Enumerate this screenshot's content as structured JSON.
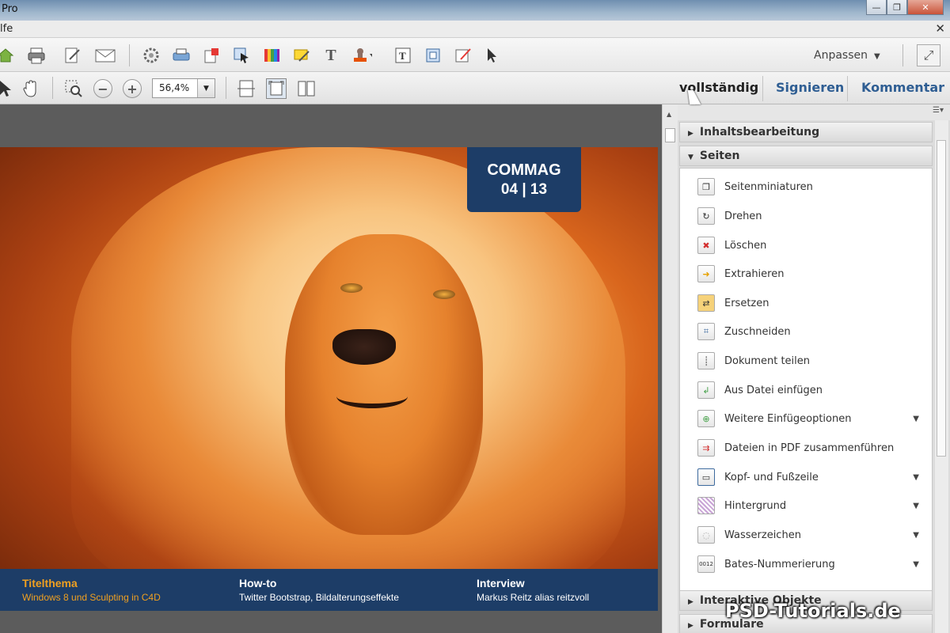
{
  "window": {
    "title": "Pro",
    "minimize": "—",
    "maximize": "❐",
    "close": "✕"
  },
  "menubar": {
    "menu_label": "lfe",
    "close": "✕"
  },
  "toolbar": {
    "icons": [
      "home-icon",
      "print-icon",
      "edit-icon",
      "mail-icon",
      "gear-icon",
      "printer2-icon",
      "export-icon",
      "select-icon",
      "color-icon",
      "comment-icon",
      "text-icon",
      "stamp-icon",
      "textbox-icon",
      "crop-icon",
      "sign-icon",
      "pointer-icon"
    ],
    "customize_label": "Anpassen",
    "fullscreen_icon": "⤢"
  },
  "navbar": {
    "zoom_value": "56,4%",
    "tabs": [
      {
        "label": "vollständig",
        "color": "#222222"
      },
      {
        "label": "Signieren",
        "color": "#2f5e93"
      },
      {
        "label": "Kommentar",
        "color": "#2f5e93"
      }
    ]
  },
  "document": {
    "badge_line1": "COMMAG",
    "badge_line2": "04 | 13",
    "footer": [
      {
        "heading": "Titelthema",
        "subtitle": "Windows 8 und Sculpting in C4D",
        "color": "#f0a020"
      },
      {
        "heading": "How-to",
        "subtitle": "Twitter Bootstrap, Bildalterungseffekte",
        "color": "#ffffff"
      },
      {
        "heading": "Interview",
        "subtitle": "Markus Reitz alias reitzvoll",
        "color": "#ffffff"
      }
    ]
  },
  "panel": {
    "sections": [
      {
        "label": "Inhaltsbearbeitung",
        "expanded": false
      },
      {
        "label": "Seiten",
        "expanded": true
      },
      {
        "label": "Interaktive Objekte",
        "expanded": false
      },
      {
        "label": "Formulare",
        "expanded": false
      }
    ],
    "items": [
      {
        "label": "Seitenminiaturen",
        "has_dropdown": false,
        "icon": "pages-icon"
      },
      {
        "label": "Drehen",
        "has_dropdown": false,
        "icon": "rotate-icon"
      },
      {
        "label": "Löschen",
        "has_dropdown": false,
        "icon": "delete-icon"
      },
      {
        "label": "Extrahieren",
        "has_dropdown": false,
        "icon": "extract-icon"
      },
      {
        "label": "Ersetzen",
        "has_dropdown": false,
        "icon": "replace-icon"
      },
      {
        "label": "Zuschneiden",
        "has_dropdown": false,
        "icon": "crop-icon"
      },
      {
        "label": "Dokument teilen",
        "has_dropdown": false,
        "icon": "split-icon"
      },
      {
        "label": "Aus Datei einfügen",
        "has_dropdown": false,
        "icon": "insert-file-icon"
      },
      {
        "label": "Weitere Einfügeoptionen",
        "has_dropdown": true,
        "icon": "insert-options-icon"
      },
      {
        "label": "Dateien in PDF zusammenführen",
        "has_dropdown": false,
        "icon": "merge-icon"
      },
      {
        "label": "Kopf- und Fußzeile",
        "has_dropdown": true,
        "icon": "header-footer-icon"
      },
      {
        "label": "Hintergrund",
        "has_dropdown": true,
        "icon": "background-icon"
      },
      {
        "label": "Wasserzeichen",
        "has_dropdown": true,
        "icon": "watermark-icon"
      },
      {
        "label": "Bates-Nummerierung",
        "has_dropdown": true,
        "icon": "bates-icon"
      }
    ]
  },
  "watermark_text": "PSD-Tutorials.de"
}
